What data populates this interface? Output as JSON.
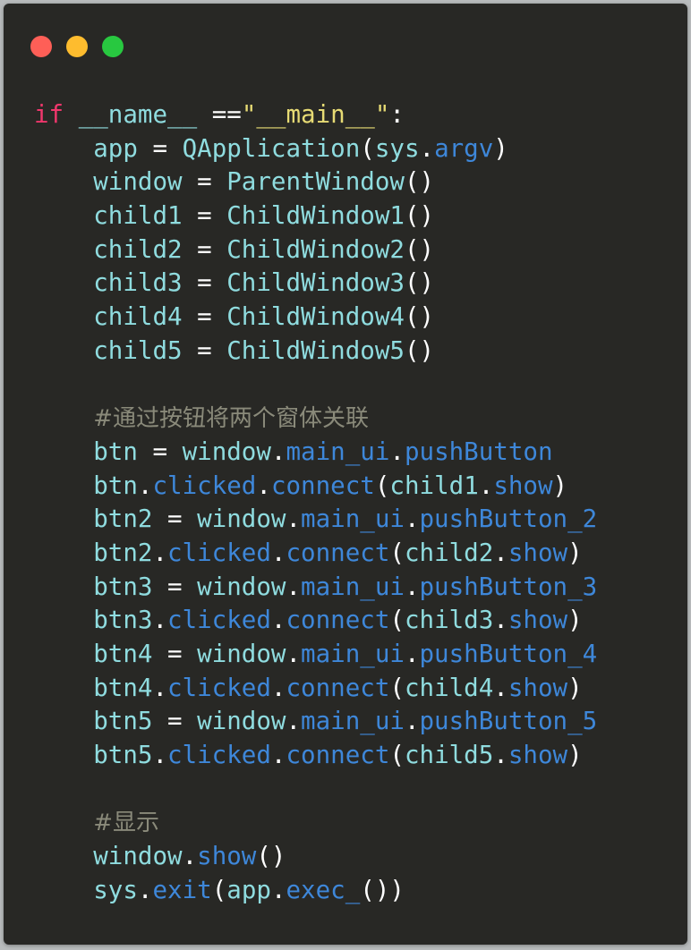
{
  "colors": {
    "background": "#282825",
    "keyword": "#f0376c",
    "string": "#e7db74",
    "default": "#ffffff",
    "identifier": "#8fdcdf",
    "attribute": "#3e87d9",
    "comment": "#8a8a7a"
  },
  "window_controls": [
    {
      "name": "close",
      "color": "#fe5f57"
    },
    {
      "name": "minimize",
      "color": "#febc2e"
    },
    {
      "name": "maximize",
      "color": "#28c840"
    }
  ],
  "code_lines": [
    [
      {
        "text": "if",
        "type": "keyword"
      },
      {
        "text": " ",
        "type": "default"
      },
      {
        "text": "__name__",
        "type": "identifier"
      },
      {
        "text": " ==",
        "type": "default"
      },
      {
        "text": "\"__main__\"",
        "type": "string"
      },
      {
        "text": ":",
        "type": "default"
      }
    ],
    [
      {
        "text": "    app",
        "type": "identifier"
      },
      {
        "text": " = ",
        "type": "default"
      },
      {
        "text": "QApplication",
        "type": "identifier"
      },
      {
        "text": "(",
        "type": "default"
      },
      {
        "text": "sys",
        "type": "identifier"
      },
      {
        "text": ".",
        "type": "default"
      },
      {
        "text": "argv",
        "type": "attribute"
      },
      {
        "text": ")",
        "type": "default"
      }
    ],
    [
      {
        "text": "    window",
        "type": "identifier"
      },
      {
        "text": " = ",
        "type": "default"
      },
      {
        "text": "ParentWindow",
        "type": "identifier"
      },
      {
        "text": "()",
        "type": "default"
      }
    ],
    [
      {
        "text": "    child1",
        "type": "identifier"
      },
      {
        "text": " = ",
        "type": "default"
      },
      {
        "text": "ChildWindow1",
        "type": "identifier"
      },
      {
        "text": "()",
        "type": "default"
      }
    ],
    [
      {
        "text": "    child2",
        "type": "identifier"
      },
      {
        "text": " = ",
        "type": "default"
      },
      {
        "text": "ChildWindow2",
        "type": "identifier"
      },
      {
        "text": "()",
        "type": "default"
      }
    ],
    [
      {
        "text": "    child3",
        "type": "identifier"
      },
      {
        "text": " = ",
        "type": "default"
      },
      {
        "text": "ChildWindow3",
        "type": "identifier"
      },
      {
        "text": "()",
        "type": "default"
      }
    ],
    [
      {
        "text": "    child4",
        "type": "identifier"
      },
      {
        "text": " = ",
        "type": "default"
      },
      {
        "text": "ChildWindow4",
        "type": "identifier"
      },
      {
        "text": "()",
        "type": "default"
      }
    ],
    [
      {
        "text": "    child5",
        "type": "identifier"
      },
      {
        "text": " = ",
        "type": "default"
      },
      {
        "text": "ChildWindow5",
        "type": "identifier"
      },
      {
        "text": "()",
        "type": "default"
      }
    ],
    [],
    [
      {
        "text": "    ",
        "type": "default"
      },
      {
        "text": "#通过按钮将两个窗体关联",
        "type": "comment"
      }
    ],
    [
      {
        "text": "    btn",
        "type": "identifier"
      },
      {
        "text": " = ",
        "type": "default"
      },
      {
        "text": "window",
        "type": "identifier"
      },
      {
        "text": ".",
        "type": "default"
      },
      {
        "text": "main_ui",
        "type": "attribute"
      },
      {
        "text": ".",
        "type": "default"
      },
      {
        "text": "pushButton",
        "type": "attribute"
      }
    ],
    [
      {
        "text": "    btn",
        "type": "identifier"
      },
      {
        "text": ".",
        "type": "default"
      },
      {
        "text": "clicked",
        "type": "attribute"
      },
      {
        "text": ".",
        "type": "default"
      },
      {
        "text": "connect",
        "type": "attribute"
      },
      {
        "text": "(",
        "type": "default"
      },
      {
        "text": "child1",
        "type": "identifier"
      },
      {
        "text": ".",
        "type": "default"
      },
      {
        "text": "show",
        "type": "attribute"
      },
      {
        "text": ")",
        "type": "default"
      }
    ],
    [
      {
        "text": "    btn2",
        "type": "identifier"
      },
      {
        "text": " = ",
        "type": "default"
      },
      {
        "text": "window",
        "type": "identifier"
      },
      {
        "text": ".",
        "type": "default"
      },
      {
        "text": "main_ui",
        "type": "attribute"
      },
      {
        "text": ".",
        "type": "default"
      },
      {
        "text": "pushButton_2",
        "type": "attribute"
      }
    ],
    [
      {
        "text": "    btn2",
        "type": "identifier"
      },
      {
        "text": ".",
        "type": "default"
      },
      {
        "text": "clicked",
        "type": "attribute"
      },
      {
        "text": ".",
        "type": "default"
      },
      {
        "text": "connect",
        "type": "attribute"
      },
      {
        "text": "(",
        "type": "default"
      },
      {
        "text": "child2",
        "type": "identifier"
      },
      {
        "text": ".",
        "type": "default"
      },
      {
        "text": "show",
        "type": "attribute"
      },
      {
        "text": ")",
        "type": "default"
      }
    ],
    [
      {
        "text": "    btn3",
        "type": "identifier"
      },
      {
        "text": " = ",
        "type": "default"
      },
      {
        "text": "window",
        "type": "identifier"
      },
      {
        "text": ".",
        "type": "default"
      },
      {
        "text": "main_ui",
        "type": "attribute"
      },
      {
        "text": ".",
        "type": "default"
      },
      {
        "text": "pushButton_3",
        "type": "attribute"
      }
    ],
    [
      {
        "text": "    btn3",
        "type": "identifier"
      },
      {
        "text": ".",
        "type": "default"
      },
      {
        "text": "clicked",
        "type": "attribute"
      },
      {
        "text": ".",
        "type": "default"
      },
      {
        "text": "connect",
        "type": "attribute"
      },
      {
        "text": "(",
        "type": "default"
      },
      {
        "text": "child3",
        "type": "identifier"
      },
      {
        "text": ".",
        "type": "default"
      },
      {
        "text": "show",
        "type": "attribute"
      },
      {
        "text": ")",
        "type": "default"
      }
    ],
    [
      {
        "text": "    btn4",
        "type": "identifier"
      },
      {
        "text": " = ",
        "type": "default"
      },
      {
        "text": "window",
        "type": "identifier"
      },
      {
        "text": ".",
        "type": "default"
      },
      {
        "text": "main_ui",
        "type": "attribute"
      },
      {
        "text": ".",
        "type": "default"
      },
      {
        "text": "pushButton_4",
        "type": "attribute"
      }
    ],
    [
      {
        "text": "    btn4",
        "type": "identifier"
      },
      {
        "text": ".",
        "type": "default"
      },
      {
        "text": "clicked",
        "type": "attribute"
      },
      {
        "text": ".",
        "type": "default"
      },
      {
        "text": "connect",
        "type": "attribute"
      },
      {
        "text": "(",
        "type": "default"
      },
      {
        "text": "child4",
        "type": "identifier"
      },
      {
        "text": ".",
        "type": "default"
      },
      {
        "text": "show",
        "type": "attribute"
      },
      {
        "text": ")",
        "type": "default"
      }
    ],
    [
      {
        "text": "    btn5",
        "type": "identifier"
      },
      {
        "text": " = ",
        "type": "default"
      },
      {
        "text": "window",
        "type": "identifier"
      },
      {
        "text": ".",
        "type": "default"
      },
      {
        "text": "main_ui",
        "type": "attribute"
      },
      {
        "text": ".",
        "type": "default"
      },
      {
        "text": "pushButton_5",
        "type": "attribute"
      }
    ],
    [
      {
        "text": "    btn5",
        "type": "identifier"
      },
      {
        "text": ".",
        "type": "default"
      },
      {
        "text": "clicked",
        "type": "attribute"
      },
      {
        "text": ".",
        "type": "default"
      },
      {
        "text": "connect",
        "type": "attribute"
      },
      {
        "text": "(",
        "type": "default"
      },
      {
        "text": "child5",
        "type": "identifier"
      },
      {
        "text": ".",
        "type": "default"
      },
      {
        "text": "show",
        "type": "attribute"
      },
      {
        "text": ")",
        "type": "default"
      }
    ],
    [],
    [
      {
        "text": "    ",
        "type": "default"
      },
      {
        "text": "#显示",
        "type": "comment"
      }
    ],
    [
      {
        "text": "    window",
        "type": "identifier"
      },
      {
        "text": ".",
        "type": "default"
      },
      {
        "text": "show",
        "type": "attribute"
      },
      {
        "text": "()",
        "type": "default"
      }
    ],
    [
      {
        "text": "    sys",
        "type": "identifier"
      },
      {
        "text": ".",
        "type": "default"
      },
      {
        "text": "exit",
        "type": "attribute"
      },
      {
        "text": "(",
        "type": "default"
      },
      {
        "text": "app",
        "type": "identifier"
      },
      {
        "text": ".",
        "type": "default"
      },
      {
        "text": "exec_",
        "type": "attribute"
      },
      {
        "text": "())",
        "type": "default"
      }
    ]
  ]
}
